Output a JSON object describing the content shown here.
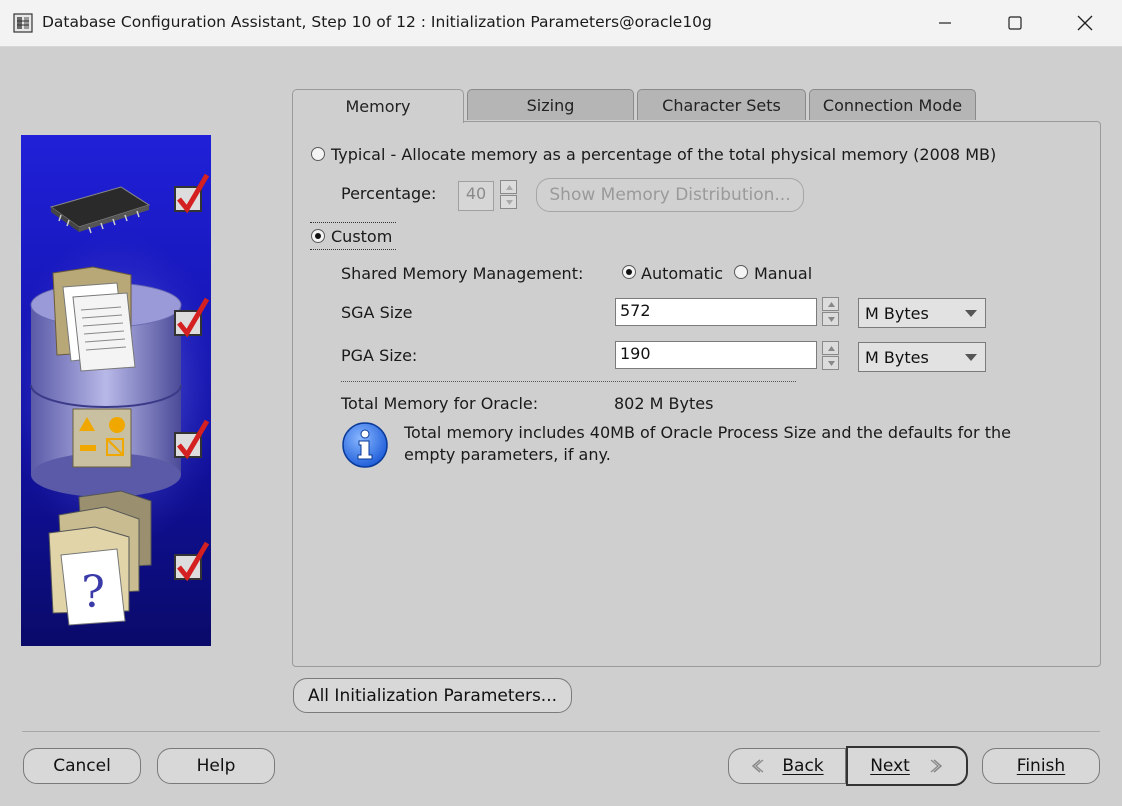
{
  "window": {
    "title": "Database Configuration Assistant, Step 10 of 12 : Initialization Parameters@oracle10g"
  },
  "tabs": [
    {
      "label": "Memory",
      "active": true
    },
    {
      "label": "Sizing",
      "active": false
    },
    {
      "label": "Character Sets",
      "active": false
    },
    {
      "label": "Connection Mode",
      "active": false
    }
  ],
  "memory": {
    "typical_label": "Typical - Allocate memory as a percentage of the total physical memory (2008 MB)",
    "typical_selected": false,
    "percentage_label": "Percentage:",
    "percentage_value": "40",
    "show_distribution_label": "Show Memory Distribution...",
    "custom_label": "Custom",
    "custom_selected": true,
    "shared_mgmt_label": "Shared Memory Management:",
    "automatic_label": "Automatic",
    "manual_label": "Manual",
    "shared_mgmt_selected": "Automatic",
    "sga_label": "SGA Size",
    "sga_value": "572",
    "sga_unit": "M Bytes",
    "pga_label": "PGA Size:",
    "pga_value": "190",
    "pga_unit": "M Bytes",
    "total_label": "Total Memory for Oracle:",
    "total_value": "802 M Bytes",
    "info_text_line1": "Total memory includes 40MB of Oracle Process Size and the defaults for the",
    "info_text_line2": "empty parameters, if any."
  },
  "all_params_button": "All Initialization Parameters...",
  "footer": {
    "cancel": "Cancel",
    "help": "Help",
    "back": "Back",
    "next": "Next",
    "finish": "Finish"
  },
  "wizard_steps_completed": 4,
  "colors": {
    "accent_blue": "#1a1ac8",
    "check_red": "#d42020"
  }
}
